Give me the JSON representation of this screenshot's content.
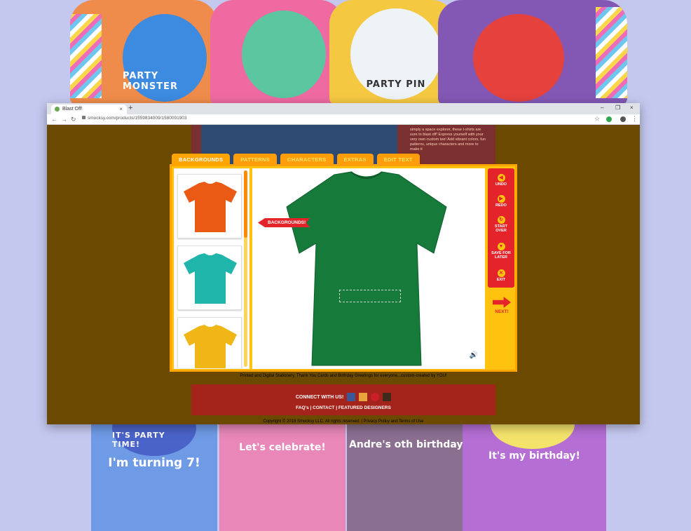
{
  "promo": {
    "top_shirts": [
      {
        "text": "PARTY MONSTER",
        "color": "#f08c4b"
      },
      {
        "text": "",
        "color": "#ee6aa1"
      },
      {
        "text": "PARTY PIN",
        "color": "#f5c842"
      },
      {
        "text": "",
        "color": "#8358b5"
      }
    ],
    "bottom_shirts": [
      {
        "text": "I'm turning 7!",
        "color": "#6f9ae6"
      },
      {
        "text": "Let's celebrate!",
        "color": "#e887b8"
      },
      {
        "text": "Andre's oth birthday!",
        "color": "#8a6f90"
      },
      {
        "text": "It's my birthday!",
        "color": "#b46ed4"
      }
    ],
    "badge_texts": [
      "IT'S PARTY TIME!"
    ]
  },
  "browser": {
    "tab_title": "Blast Off!",
    "tab_close": "×",
    "new_tab": "+",
    "url": "smocksy.com/products/1559834009/1580091903",
    "win_min": "–",
    "win_max": "❐",
    "win_close": "×",
    "back": "←",
    "forward": "→",
    "reload": "↻",
    "star": "☆"
  },
  "site": {
    "description": "simply a space explorer, these t-shirts are sure to blast off! Express yourself with your very own custom tee! Add vibrant colors, fun patterns, unique characters and more to make it",
    "tagline": "Printed and Digital Stationery, Thank You Cards and Birthday Greetings for everyone...custom-created by YOU!",
    "connect": "CONNECT WITH US!",
    "links": "FAQ's | CONTACT | FEATURED DESIGNERS",
    "copyright": "Copyright © 2018 Smocksy LLC. All rights reserved. | Privacy Policy and Terms of Use"
  },
  "builder": {
    "tabs": [
      "BACKGROUNDS",
      "PATTERNS",
      "CHARACTERS",
      "EXTRAS",
      "EDIT TEXT"
    ],
    "flag": "BACKGROUNDS!",
    "swatches": [
      {
        "name": "orange",
        "color": "#ea5a14"
      },
      {
        "name": "turquoise",
        "color": "#1fb5aa"
      },
      {
        "name": "yellow",
        "color": "#f0b617"
      }
    ],
    "shirt_color": "#157a3a",
    "menu": {
      "undo": "UNDO",
      "redo": "REDO",
      "start_over_1": "START",
      "start_over_2": "OVER",
      "save_1": "SAVE FOR",
      "save_2": "LATER",
      "exit": "EXIT"
    },
    "next": "NEXT!",
    "speaker": "🔊"
  }
}
